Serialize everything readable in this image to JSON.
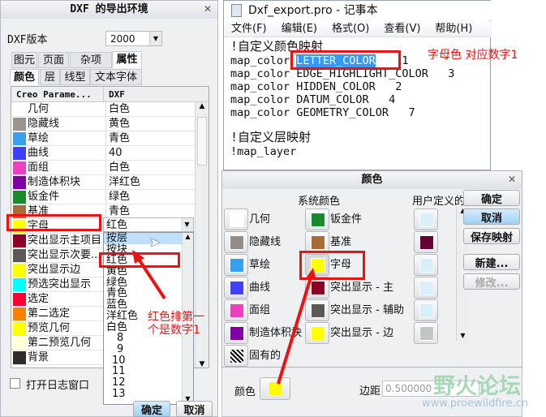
{
  "dxf_dialog": {
    "title": "DXF 的导出环境",
    "version_label": "DXF版本",
    "version_value": "2000",
    "tabs": [
      "图元",
      "页面",
      "杂项",
      "属性"
    ],
    "subtabs": [
      "颜色",
      "层",
      "线型",
      "文本字体"
    ],
    "columns": [
      "Creo Parame...",
      "DXF"
    ],
    "rows": [
      {
        "name": "几何",
        "value": "白色",
        "color": "#ffffff"
      },
      {
        "name": "隐藏线",
        "value": "黄色",
        "color": "#9a948d"
      },
      {
        "name": "草绘",
        "value": "青色",
        "color": "#3aa0ee"
      },
      {
        "name": "曲线",
        "value": "40",
        "color": "#3f3ffc"
      },
      {
        "name": "面组",
        "value": "白色",
        "color": "#ee3fc0"
      },
      {
        "name": "制造体积块",
        "value": "洋红色",
        "color": "#8000a6"
      },
      {
        "name": "钣金件",
        "value": "绿色",
        "color": "#188a30"
      },
      {
        "name": "基准",
        "value": "青色",
        "color": "#a86c36"
      },
      {
        "name": "字母",
        "value": "红色",
        "color": "#ffff00"
      },
      {
        "name": "突出显示主项目",
        "value": "",
        "color": "#8e0026"
      },
      {
        "name": "突出显示次要...",
        "value": "",
        "color": "#5a5955"
      },
      {
        "name": "突出显示边",
        "value": "",
        "color": "#ffff00"
      },
      {
        "name": "预选突出显示",
        "value": "",
        "color": "#00ffff"
      },
      {
        "name": "选定",
        "value": "",
        "color": "#ff0033"
      },
      {
        "name": "第二选定",
        "value": "",
        "color": "#ff8000"
      },
      {
        "name": "预览几何",
        "value": "",
        "color": "#ffff00"
      },
      {
        "name": "第二预览几何",
        "value": "",
        "color": "#ffffd8"
      },
      {
        "name": "背景",
        "value": "",
        "color": "#302c28"
      }
    ],
    "dropdown_options": [
      "按层",
      "按块",
      "红色",
      "黄色",
      "绿色",
      "青色",
      "蓝色",
      "洋红色",
      "白色",
      "8",
      "9",
      "10",
      "11",
      "12",
      "13"
    ],
    "log_checkbox": "打开日志窗口",
    "ok": "确定",
    "cancel": "取消"
  },
  "notepad": {
    "title": "Dxf_export.pro - 记事本",
    "menu": [
      "文件(F)",
      "编辑(E)",
      "格式(O)",
      "查看(V)",
      "帮助(H)"
    ],
    "lines": [
      "!自定义颜色映射",
      "map_color ",
      "LETTER_COLOR",
      "    1",
      "map_color EDGE_HIGHLIGHT_COLOR   3",
      "map_color HIDDEN_COLOR   2",
      "map_color DATUM_COLOR   4",
      "map_color GEOMETRY_COLOR   7",
      "",
      "!自定义层映射",
      "!map_layer"
    ]
  },
  "color_dialog": {
    "title": "颜色",
    "system_header": "系统颜色",
    "user_header": "用户定义的",
    "left": [
      {
        "label": "几何",
        "color": "#ffffff"
      },
      {
        "label": "隐藏线",
        "color": "#928d86"
      },
      {
        "label": "草绘",
        "color": "#35a0ee"
      },
      {
        "label": "曲线",
        "color": "#3f3ffc"
      },
      {
        "label": "面组",
        "color": "#ee3fc0"
      },
      {
        "label": "制造体积块",
        "color": "#8000a6"
      },
      {
        "label": "固有的",
        "color": "hatch"
      }
    ],
    "right": [
      {
        "label": "钣金件",
        "color": "#188a30"
      },
      {
        "label": "基准",
        "color": "#a86c36"
      },
      {
        "label": "字母",
        "color": "#ffff00"
      },
      {
        "label": "突出显示 - 主",
        "color": "#8e0026"
      },
      {
        "label": "突出显示 - 辅助",
        "color": "#5a5955"
      },
      {
        "label": "突出显示 - 边",
        "color": "#ffff00"
      }
    ],
    "user": [
      "#ddeefb",
      "#650033",
      "#ddeefb",
      "#ddeefb",
      "#ddeefb",
      "#c4c4c4"
    ],
    "buttons": [
      "确定",
      "取消",
      "保存映射",
      "新建...",
      "修改..."
    ]
  },
  "underlying": {
    "color_label": "颜色",
    "margin_label": "边距",
    "margin_value": "0.500000",
    "swatch": "#ffff00"
  },
  "annotations": {
    "note1": "字母色 对应数字1",
    "note2_line1": "红色排第一",
    "note2_line2": "个是数字1"
  },
  "watermark": {
    "text": "野火论坛",
    "url": "www.proewildfire.cn"
  }
}
